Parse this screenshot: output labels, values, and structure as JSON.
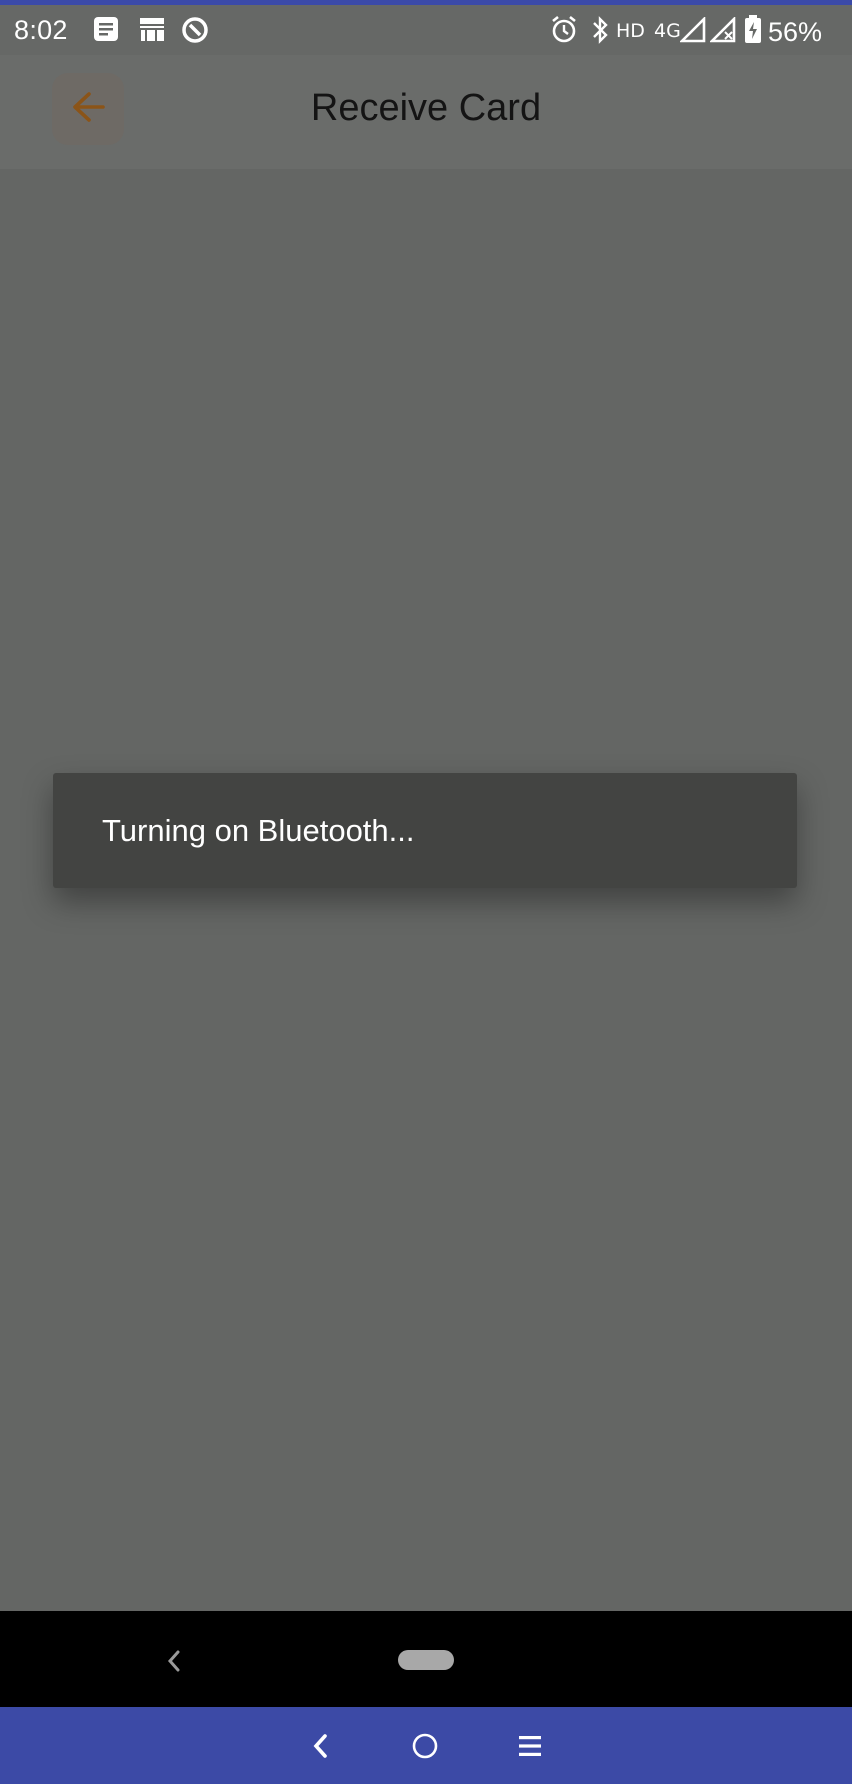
{
  "status_bar": {
    "time": "8:02",
    "network_hd": "HD",
    "network_type": "4G",
    "battery_percent": "56%",
    "icons": [
      "document-icon",
      "tata-1mg-icon",
      "app-icon",
      "alarm-icon",
      "bluetooth-icon",
      "signal-icon",
      "signal-no-service-icon",
      "battery-charging-icon"
    ]
  },
  "app_bar": {
    "back_icon": "arrow-left-icon",
    "title": "Receive Card",
    "accent_color": "#d36a13"
  },
  "toast": {
    "message": "Turning on Bluetooth..."
  },
  "nav_bar": {
    "inner_icons": [
      "back-chevron-icon",
      "home-pill-icon"
    ],
    "outer_icons": [
      "back-chevron-icon",
      "home-circle-icon",
      "menu-icon"
    ],
    "outer_color": "#3c4aa6"
  }
}
